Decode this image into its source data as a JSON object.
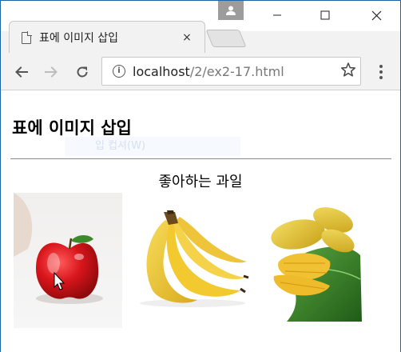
{
  "browser": {
    "tab_title": "표에 이미지 삽입",
    "tab_close": "×",
    "url_host": "localhost",
    "url_path": "/2/ex2-17.html"
  },
  "page": {
    "heading": "표에 이미지 삽입",
    "faint_text": "입 컵셔(W)",
    "table_caption": "좋아하는 과일"
  },
  "fruits": [
    {
      "name": "apple",
      "icon": "apple-image"
    },
    {
      "name": "banana",
      "icon": "banana-image"
    },
    {
      "name": "mango",
      "icon": "mango-image"
    }
  ],
  "colors": {
    "window_border": "#1c64a8",
    "chrome_bg": "#f2f2f2",
    "apple_red": "#d8151b",
    "banana_yellow": "#f2c92e",
    "mango_yellow": "#e8c634",
    "leaf_green": "#3c8a2c"
  }
}
